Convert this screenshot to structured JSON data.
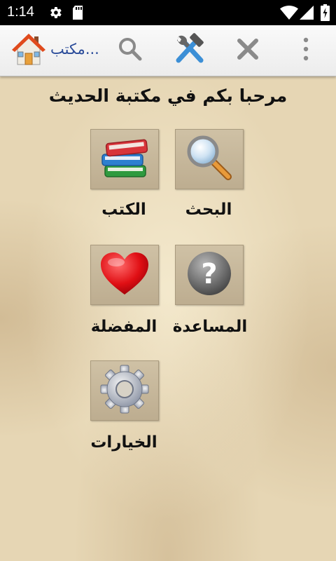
{
  "status_bar": {
    "time": "1:14",
    "icons": [
      "gear-icon",
      "sd-card-icon",
      "wifi-icon",
      "signal-icon",
      "battery-charging-icon"
    ]
  },
  "action_bar": {
    "title": "مكتب...",
    "icons": [
      "home-icon",
      "search-icon",
      "tools-icon",
      "close-icon",
      "overflow-menu-icon"
    ]
  },
  "welcome_text": "مرحبا بكم في مكتبة الحديث",
  "tiles": [
    {
      "id": "search",
      "label": "البحث",
      "icon": "magnifier-icon"
    },
    {
      "id": "books",
      "label": "الكتب",
      "icon": "books-icon"
    },
    {
      "id": "help",
      "label": "المساعدة",
      "icon": "question-icon"
    },
    {
      "id": "favorites",
      "label": "المفضلة",
      "icon": "heart-icon"
    },
    {
      "id": "options",
      "label": "الخيارات",
      "icon": "gear-icon"
    }
  ],
  "colors": {
    "status_bar_bg": "#000000",
    "action_bar_bg": "#f2f2f2",
    "title_color": "#2b4c9a",
    "parchment": "#e6d6b4"
  }
}
